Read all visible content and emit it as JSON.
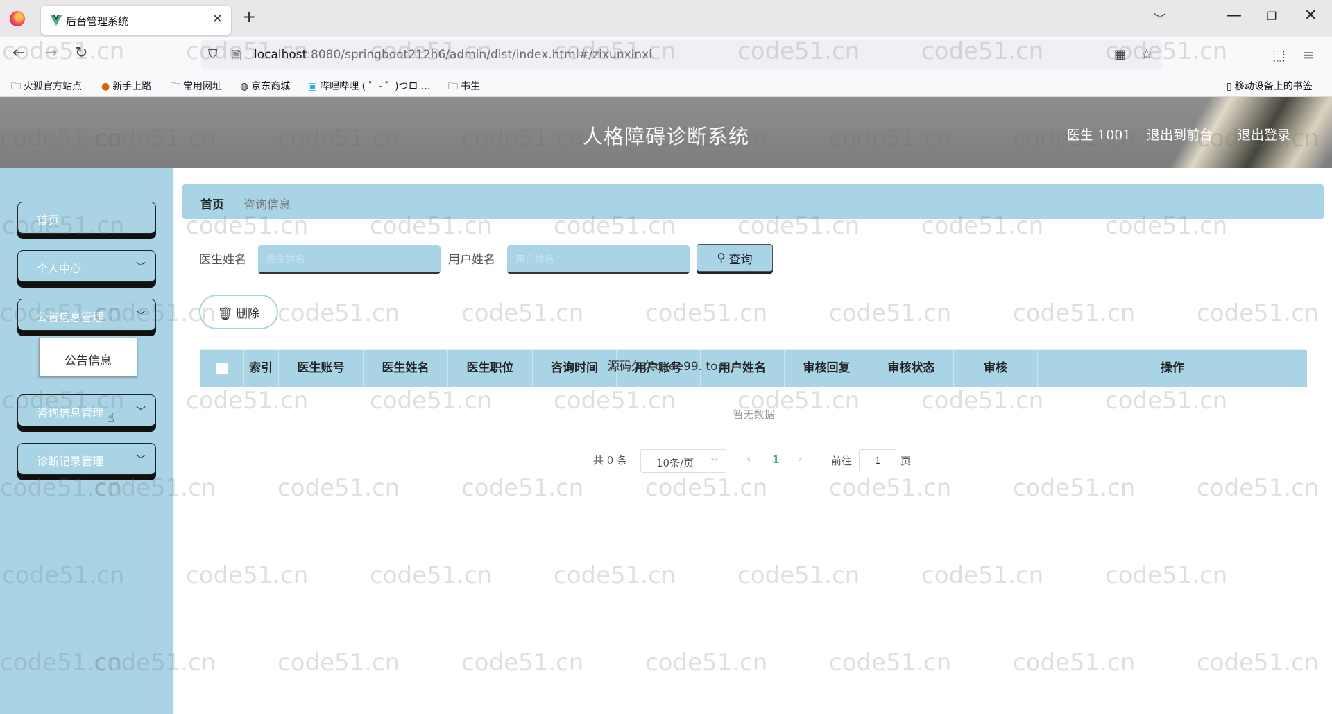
{
  "browser": {
    "tab_title": "后台管理系统",
    "tab_close": "✕",
    "new_tab": "+",
    "url_host": "localhost",
    "url_rest": ":8080/springboot212h6/admin/dist/index.html#/zixunxinxi",
    "bookmarks": [
      {
        "icon": "folder-icon",
        "label": "火狐官方站点"
      },
      {
        "icon": "firefox-icon",
        "label": "新手上路"
      },
      {
        "icon": "folder-icon",
        "label": "常用网址"
      },
      {
        "icon": "globe-icon",
        "label": "京东商城"
      },
      {
        "icon": "bilibili-icon",
        "label": "哔哩哔哩 ( ゜- ゜)つロ ..."
      },
      {
        "icon": "folder-icon",
        "label": "书生"
      }
    ],
    "mobile_bookmarks": "移动设备上的书签"
  },
  "header": {
    "title": "人格障碍诊断系统",
    "user": "医生 1001",
    "to_front": "退出到前台",
    "logout": "退出登录"
  },
  "sidebar": {
    "items": [
      {
        "label": "首页",
        "has_caret": false
      },
      {
        "label": "个人中心",
        "has_caret": true
      },
      {
        "label": "公告信息管理",
        "has_caret": true
      },
      {
        "label": "咨询信息管理",
        "has_caret": true
      },
      {
        "label": "诊断记录管理",
        "has_caret": true
      }
    ],
    "submenu_label": "公告信息"
  },
  "breadcrumb": {
    "home": "首页",
    "current": "咨询信息"
  },
  "search": {
    "doctor_label": "医生姓名",
    "doctor_placeholder": "医生姓名",
    "user_label": "用户姓名",
    "user_placeholder": "用户姓名",
    "query_label": "查询"
  },
  "actions": {
    "delete_label": "删除"
  },
  "table": {
    "columns": [
      "索引",
      "医生账号",
      "医生姓名",
      "医生职位",
      "咨询时间",
      "用户账号",
      "用户姓名",
      "审核回复",
      "审核状态",
      "审核",
      "操作"
    ],
    "empty_text": "暂无数据"
  },
  "pagination": {
    "total": "共 0 条",
    "page_size": "10条/页",
    "current_page": "1",
    "goto_label": "前往",
    "goto_value": "1",
    "goto_unit": "页"
  },
  "overlay_note": "源码久久code99. top",
  "watermark": "code51.cn",
  "colors": {
    "accent": "#a9d4e6",
    "header": "#858585",
    "active_page": "#3bb36b"
  }
}
